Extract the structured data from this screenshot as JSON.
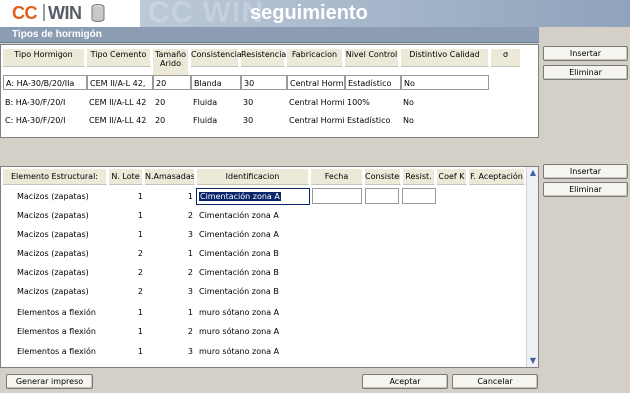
{
  "app": {
    "logo_left": "CC",
    "logo_right": "WIN",
    "watermark": "CC WIN",
    "subtitle": "seguimiento"
  },
  "section_title": "Tipos de hormigón",
  "tipos": {
    "columns": [
      "Tipo Hormigon",
      "Tipo Cemento",
      "Tamaño Arido",
      "Consistencia",
      "Resistencia",
      "Fabricacion",
      "Nivel Control",
      "Distintivo Calidad",
      "σ"
    ],
    "rows": [
      {
        "tipo": "A: HA-30/B/20/IIa",
        "cemento": "CEM II/A-L 42,",
        "arido": "20",
        "consistencia": "Blanda",
        "resistencia": "30",
        "fabricacion": "Central Hormig",
        "nivel": "Estadístico",
        "distintivo": "No"
      },
      {
        "tipo": "B: HA-30/F/20/I",
        "cemento": "CEM II/A-LL 42",
        "arido": "20",
        "consistencia": "Fluida",
        "resistencia": "30",
        "fabricacion": "Central Hormig",
        "nivel": "100%",
        "distintivo": "No"
      },
      {
        "tipo": "C: HA-30/F/20/I",
        "cemento": "CEM II/A-LL 42",
        "arido": "20",
        "consistencia": "Fluida",
        "resistencia": "30",
        "fabricacion": "Central Hormig",
        "nivel": "Estadístico",
        "distintivo": "No"
      }
    ]
  },
  "elementos": {
    "columns": [
      "Elemento Estructural:",
      "N. Lote",
      "N.Amasadas",
      "Identificacion",
      "Fecha",
      "Consisten.",
      "Resist.",
      "Coef K",
      "F. Aceptación"
    ],
    "rows": [
      {
        "elemento": "Macizos (zapatas)",
        "lote": "1",
        "amasadas": "1",
        "identificacion": "Cimentación zona A"
      },
      {
        "elemento": "Macizos (zapatas)",
        "lote": "1",
        "amasadas": "2",
        "identificacion": "Cimentación zona A"
      },
      {
        "elemento": "Macizos (zapatas)",
        "lote": "1",
        "amasadas": "3",
        "identificacion": "Cimentación zona A"
      },
      {
        "elemento": "Macizos (zapatas)",
        "lote": "2",
        "amasadas": "1",
        "identificacion": "Cimentación zona B"
      },
      {
        "elemento": "Macizos (zapatas)",
        "lote": "2",
        "amasadas": "2",
        "identificacion": "Cimentación zona B"
      },
      {
        "elemento": "Macizos (zapatas)",
        "lote": "2",
        "amasadas": "3",
        "identificacion": "Cimentación zona B"
      },
      {
        "elemento": "Elementos a flexión",
        "lote": "1",
        "amasadas": "1",
        "identificacion": "muro sótano zona A"
      },
      {
        "elemento": "Elementos a flexión",
        "lote": "1",
        "amasadas": "2",
        "identificacion": "muro sótano zona A"
      },
      {
        "elemento": "Elementos a flexión",
        "lote": "1",
        "amasadas": "3",
        "identificacion": "muro sótano zona A"
      }
    ]
  },
  "buttons": {
    "insertar_1": "Insertar",
    "eliminar_1": "Eliminar",
    "insertar_2": "Insertar",
    "eliminar_2": "Eliminar",
    "generar": "Generar impreso",
    "aceptar": "Aceptar",
    "cancelar": "Cancelar"
  }
}
